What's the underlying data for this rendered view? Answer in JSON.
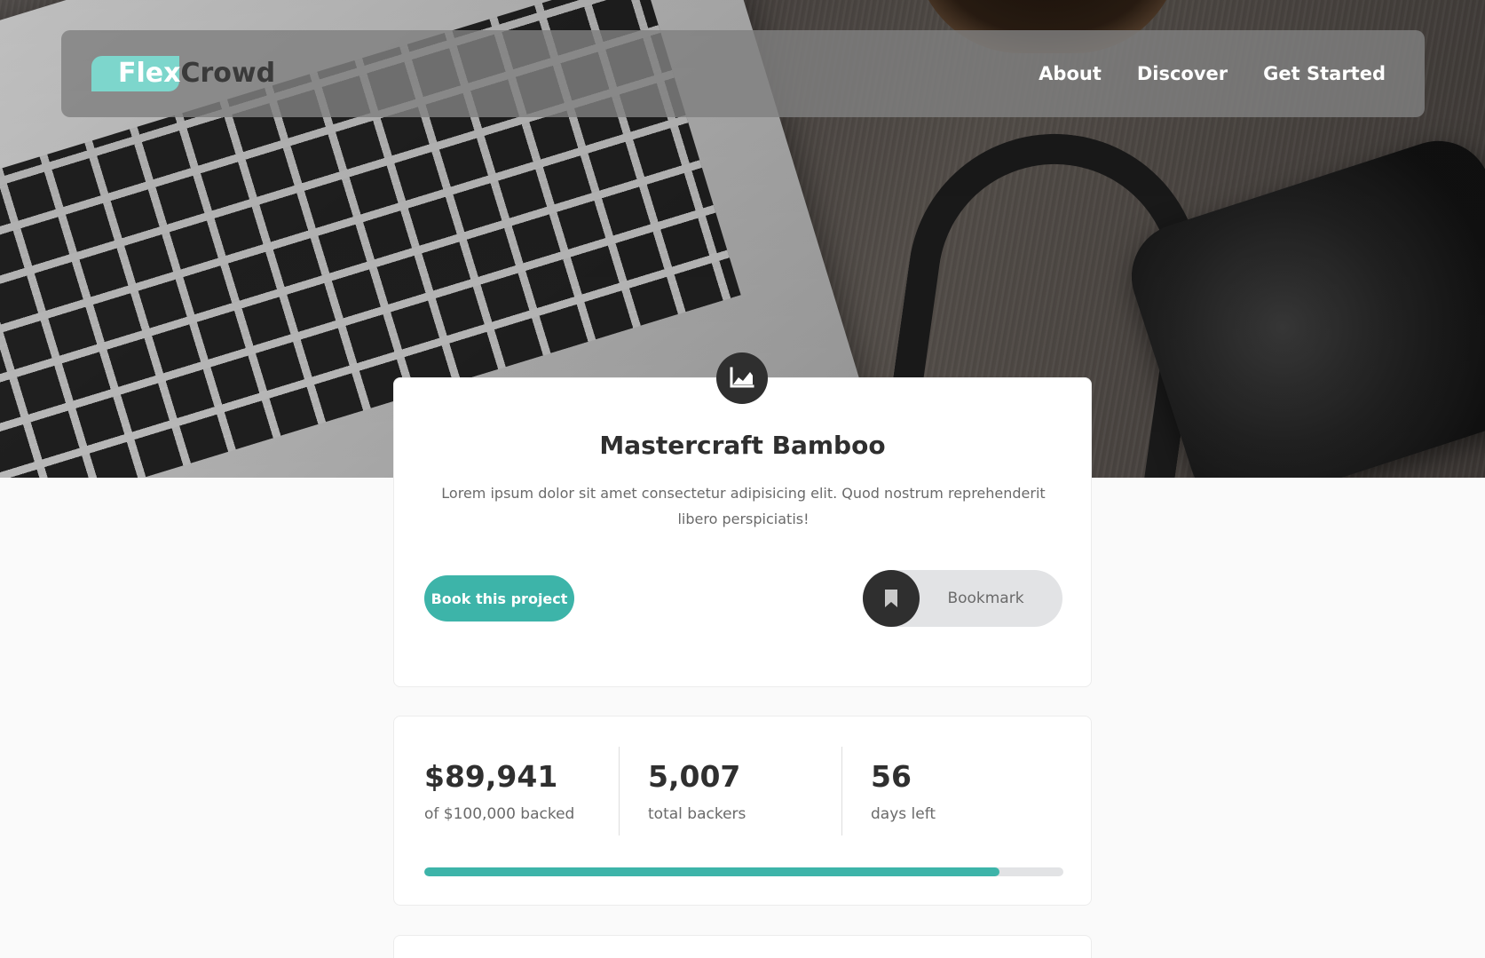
{
  "nav": {
    "logo_part1": "Flex",
    "logo_part2": "Crowd",
    "links": [
      "About",
      "Discover",
      "Get Started"
    ]
  },
  "project": {
    "icon": "chart-line-icon",
    "title": "Mastercraft Bamboo",
    "description": "Lorem ipsum dolor sit amet consectetur adipisicing elit. Quod nostrum reprehenderit libero perspiciatis!",
    "book_button": "Book this project",
    "bookmark_button": "Bookmark",
    "bookmark_icon": "bookmark-icon"
  },
  "stats": [
    {
      "value": "$89,941",
      "label": "of $100,000 backed"
    },
    {
      "value": "5,007",
      "label": "total backers"
    },
    {
      "value": "56",
      "label": "days left"
    }
  ],
  "progress": {
    "fraction": 0.8994
  },
  "colors": {
    "accent": "#3db4a9",
    "logo_mark": "#7dd6cc",
    "dark": "#2f2f2f",
    "muted": "#6a6a6a"
  }
}
